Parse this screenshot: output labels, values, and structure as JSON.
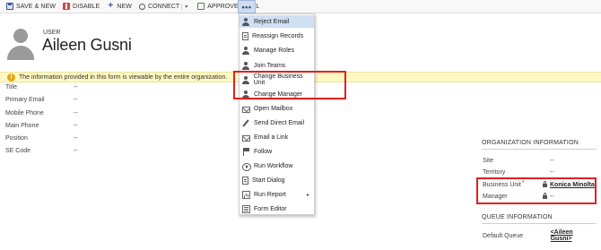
{
  "toolbar": {
    "save_new": "SAVE & NEW",
    "disable": "DISABLE",
    "new": "NEW",
    "connect": "CONNECT",
    "connect_caret": "▾",
    "approve_email": "APPROVE EMAIL",
    "more": "•••"
  },
  "header": {
    "entity_type": "USER",
    "record_name": "Aileen Gusni"
  },
  "notification": {
    "icon": "!",
    "text": "The information provided in this form is viewable by the entire organization."
  },
  "fields": [
    {
      "label": "Title",
      "value": "--"
    },
    {
      "label": "Primary Email",
      "value": "--"
    },
    {
      "label": "Mobile Phone",
      "value": "--"
    },
    {
      "label": "Main Phone",
      "value": "--"
    },
    {
      "label": "Position",
      "value": "--"
    },
    {
      "label": "SE Code",
      "value": "--"
    }
  ],
  "menu": [
    {
      "label": "Reject Email",
      "icon": "person-icon"
    },
    {
      "label": "Reassign Records",
      "icon": "document-icon"
    },
    {
      "label": "Manage Roles",
      "icon": "person-icon"
    },
    {
      "label": "Join Teams",
      "icon": "person-icon"
    },
    {
      "label": "Change Business Unit",
      "icon": "person-icon"
    },
    {
      "label": "Change Manager",
      "icon": "person-icon"
    },
    {
      "label": "Open Mailbox",
      "icon": "mail-icon"
    },
    {
      "label": "Send Direct Email",
      "icon": "pen-icon"
    },
    {
      "label": "Email a Link",
      "icon": "mail-icon"
    },
    {
      "label": "Follow",
      "icon": "flag-icon"
    },
    {
      "label": "Run Workflow",
      "icon": "workflow-icon"
    },
    {
      "label": "Start Dialog",
      "icon": "document-icon"
    },
    {
      "label": "Run Report",
      "icon": "report-icon",
      "arrow": "▸"
    },
    {
      "label": "Form Editor",
      "icon": "form-icon"
    }
  ],
  "org_info": {
    "title": "ORGANIZATION INFORMATION",
    "site_label": "Site",
    "site_value": "--",
    "territory_label": "Territory",
    "territory_value": "--",
    "business_unit_label": "Business Unit",
    "business_unit_required": "*",
    "business_unit_value": "Konica Minolta",
    "manager_label": "Manager",
    "manager_value": "--"
  },
  "queue_info": {
    "title": "QUEUE INFORMATION",
    "default_queue_label": "Default Queue",
    "default_queue_value": "<Aileen Gusni>"
  },
  "colors": {
    "highlight_box": "#e02020",
    "menu_hover": "#cfe0f4",
    "notice_bg": "#fff8c2",
    "warning_icon": "#e6a817"
  }
}
